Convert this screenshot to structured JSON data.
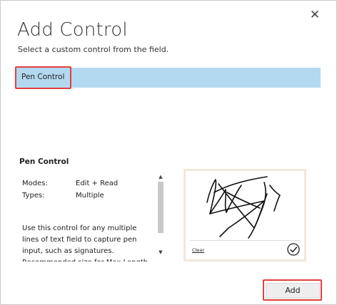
{
  "dialog": {
    "close_glyph": "✕",
    "title": "Add Control",
    "subtitle": "Select a custom control from the field."
  },
  "controls": [
    {
      "label": "Pen Control",
      "selected": true
    }
  ],
  "details": {
    "title": "Pen Control",
    "modes_label": "Modes:",
    "modes_value": "Edit + Read",
    "types_label": "Types:",
    "types_value": "Multiple",
    "description": "Use this control for any multiple lines of text field to capture pen input, such as signatures. Recommended size for Max Length of the field is"
  },
  "preview": {
    "clear_label": "Clear",
    "check_icon": "check-circle-icon",
    "signature_icon": "signature-scribble"
  },
  "footer": {
    "add_label": "Add"
  },
  "colors": {
    "selection": "#b3d9f0",
    "highlight": "#e0403e",
    "preview_border": "#f1e7dc"
  }
}
